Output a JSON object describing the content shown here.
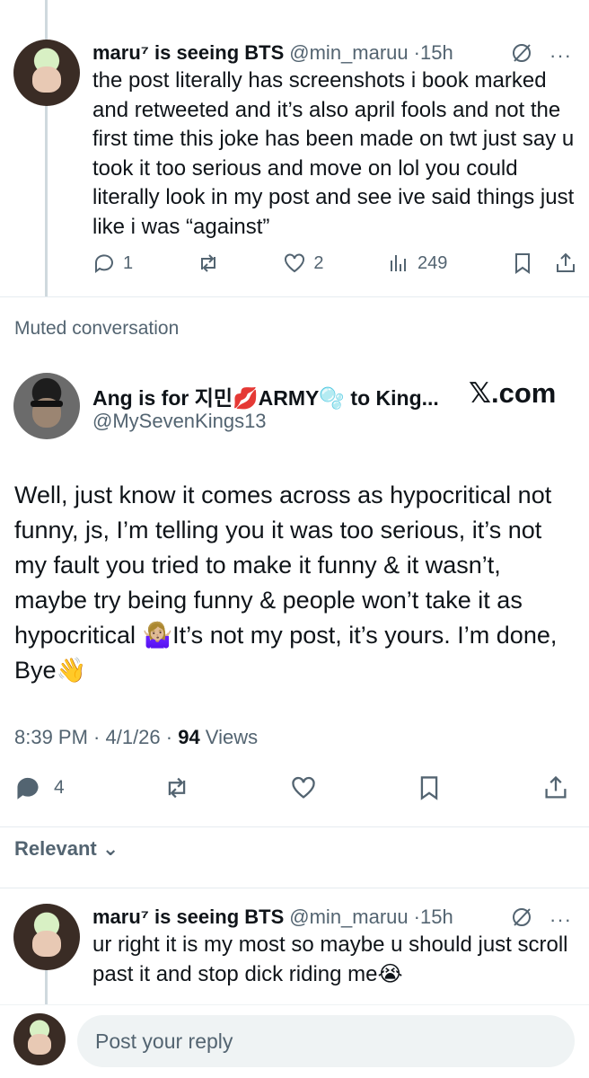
{
  "first_tweet": {
    "name": "maru⁷ is seeing BTS",
    "handle": "@min_maruu",
    "time": "·15h",
    "text": "the post literally has screenshots i book marked and retweeted and it’s also april fools and not the first time this joke has been made on twt just say u took it too serious and move on lol you could literally look in my post and see ive said things just like i was “against”",
    "replies": "1",
    "likes": "2",
    "views": "249",
    "more": "···"
  },
  "muted_label": "Muted conversation",
  "main_tweet": {
    "name": "Ang is for 지민💋ARMY🫧 to King...",
    "handle": "@MySevenKings13",
    "brand": "𝕏.com",
    "text": "Well, just know it comes across as hypocritical not funny, js, I’m telling you it was too serious, it’s not my fault you tried to make it funny & it wasn’t, maybe try being funny & people won’t take it as hypocritical 🤷🏼‍♀️It’s not my post, it’s yours. I’m done, Bye👋",
    "time": "8:39 PM · 4/1/26 · ",
    "views_count": "94",
    "views_label": " Views",
    "replies": "4"
  },
  "sort_label": "Relevant ⌄",
  "reply_tweet": {
    "name": "maru⁷ is seeing BTS",
    "handle": "@min_maruu",
    "time": "·15h",
    "text": "ur right it is my most so maybe u should just scroll past it and stop dick riding me😭",
    "more": "···"
  },
  "composer": {
    "placeholder": "Post your reply"
  }
}
